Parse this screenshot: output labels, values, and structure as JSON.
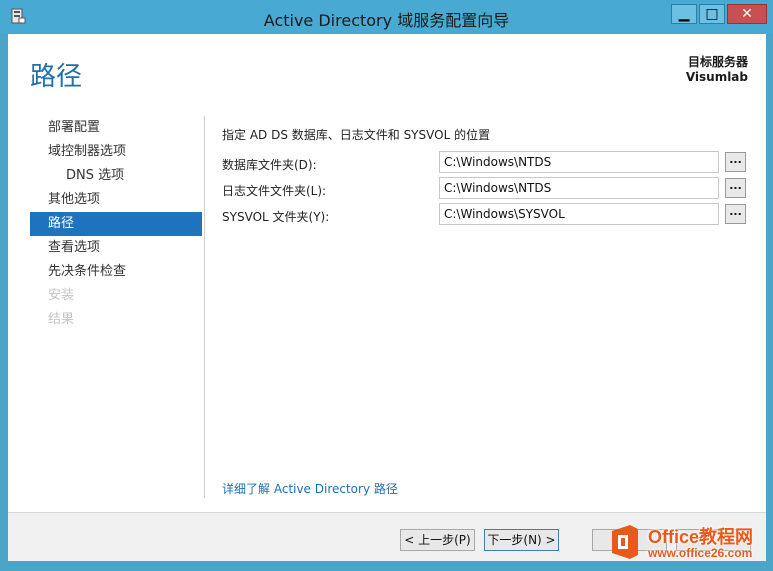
{
  "window": {
    "title": "Active Directory 域服务配置向导",
    "minimize_label": "▁",
    "maximize_label": "□",
    "close_label": "✕",
    "icon": "server-icon"
  },
  "header": {
    "page_title": "路径",
    "target_label": "目标服务器",
    "target_server": "Visumlab"
  },
  "nav": {
    "items": [
      {
        "label": "部署配置",
        "state": "normal"
      },
      {
        "label": "域控制器选项",
        "state": "normal"
      },
      {
        "label": "DNS 选项",
        "state": "sub"
      },
      {
        "label": "其他选项",
        "state": "normal"
      },
      {
        "label": "路径",
        "state": "active"
      },
      {
        "label": "查看选项",
        "state": "normal"
      },
      {
        "label": "先决条件检查",
        "state": "normal"
      },
      {
        "label": "安装",
        "state": "disabled"
      },
      {
        "label": "结果",
        "state": "disabled"
      }
    ]
  },
  "main": {
    "instruction": "指定 AD DS 数据库、日志文件和 SYSVOL 的位置",
    "fields": [
      {
        "label": "数据库文件夹(D):",
        "value": "C:\\Windows\\NTDS",
        "browse": "..."
      },
      {
        "label": "日志文件文件夹(L):",
        "value": "C:\\Windows\\NTDS",
        "browse": "..."
      },
      {
        "label": "SYSVOL 文件夹(Y):",
        "value": "C:\\Windows\\SYSVOL",
        "browse": "..."
      }
    ],
    "learn_more": "详细了解 Active Directory 路径"
  },
  "footer": {
    "prev_label": "< 上一步(P)",
    "next_label": "下一步(N) >",
    "install_label": "",
    "cancel_label": ""
  },
  "watermark": {
    "brand": "Office教程网",
    "url": "www.office26.com"
  },
  "colors": {
    "accent": "#1e73be",
    "title_blue": "#1e6fb0",
    "titlebar": "#48a9d2",
    "close": "#c75050",
    "logo_orange": "#e85a1c"
  }
}
